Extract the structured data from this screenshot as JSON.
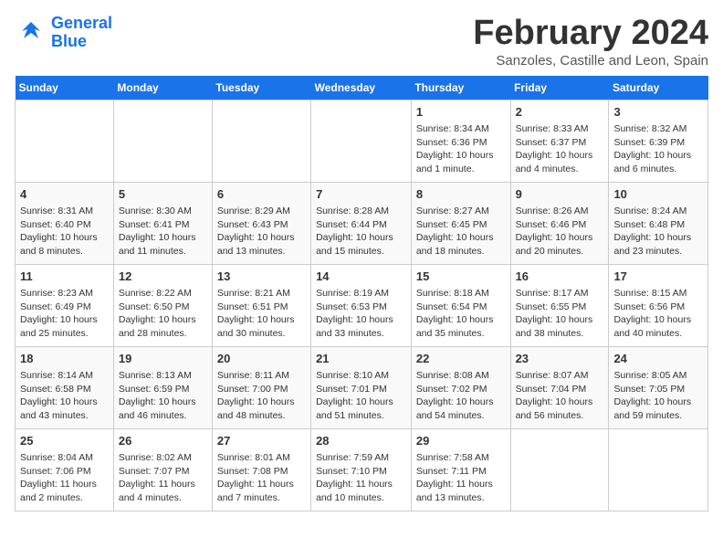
{
  "header": {
    "logo_line1": "General",
    "logo_line2": "Blue",
    "month_title": "February 2024",
    "location": "Sanzoles, Castille and Leon, Spain"
  },
  "days_of_week": [
    "Sunday",
    "Monday",
    "Tuesday",
    "Wednesday",
    "Thursday",
    "Friday",
    "Saturday"
  ],
  "weeks": [
    [
      {
        "day": "",
        "content": ""
      },
      {
        "day": "",
        "content": ""
      },
      {
        "day": "",
        "content": ""
      },
      {
        "day": "",
        "content": ""
      },
      {
        "day": "1",
        "content": "Sunrise: 8:34 AM\nSunset: 6:36 PM\nDaylight: 10 hours and 1 minute."
      },
      {
        "day": "2",
        "content": "Sunrise: 8:33 AM\nSunset: 6:37 PM\nDaylight: 10 hours and 4 minutes."
      },
      {
        "day": "3",
        "content": "Sunrise: 8:32 AM\nSunset: 6:39 PM\nDaylight: 10 hours and 6 minutes."
      }
    ],
    [
      {
        "day": "4",
        "content": "Sunrise: 8:31 AM\nSunset: 6:40 PM\nDaylight: 10 hours and 8 minutes."
      },
      {
        "day": "5",
        "content": "Sunrise: 8:30 AM\nSunset: 6:41 PM\nDaylight: 10 hours and 11 minutes."
      },
      {
        "day": "6",
        "content": "Sunrise: 8:29 AM\nSunset: 6:43 PM\nDaylight: 10 hours and 13 minutes."
      },
      {
        "day": "7",
        "content": "Sunrise: 8:28 AM\nSunset: 6:44 PM\nDaylight: 10 hours and 15 minutes."
      },
      {
        "day": "8",
        "content": "Sunrise: 8:27 AM\nSunset: 6:45 PM\nDaylight: 10 hours and 18 minutes."
      },
      {
        "day": "9",
        "content": "Sunrise: 8:26 AM\nSunset: 6:46 PM\nDaylight: 10 hours and 20 minutes."
      },
      {
        "day": "10",
        "content": "Sunrise: 8:24 AM\nSunset: 6:48 PM\nDaylight: 10 hours and 23 minutes."
      }
    ],
    [
      {
        "day": "11",
        "content": "Sunrise: 8:23 AM\nSunset: 6:49 PM\nDaylight: 10 hours and 25 minutes."
      },
      {
        "day": "12",
        "content": "Sunrise: 8:22 AM\nSunset: 6:50 PM\nDaylight: 10 hours and 28 minutes."
      },
      {
        "day": "13",
        "content": "Sunrise: 8:21 AM\nSunset: 6:51 PM\nDaylight: 10 hours and 30 minutes."
      },
      {
        "day": "14",
        "content": "Sunrise: 8:19 AM\nSunset: 6:53 PM\nDaylight: 10 hours and 33 minutes."
      },
      {
        "day": "15",
        "content": "Sunrise: 8:18 AM\nSunset: 6:54 PM\nDaylight: 10 hours and 35 minutes."
      },
      {
        "day": "16",
        "content": "Sunrise: 8:17 AM\nSunset: 6:55 PM\nDaylight: 10 hours and 38 minutes."
      },
      {
        "day": "17",
        "content": "Sunrise: 8:15 AM\nSunset: 6:56 PM\nDaylight: 10 hours and 40 minutes."
      }
    ],
    [
      {
        "day": "18",
        "content": "Sunrise: 8:14 AM\nSunset: 6:58 PM\nDaylight: 10 hours and 43 minutes."
      },
      {
        "day": "19",
        "content": "Sunrise: 8:13 AM\nSunset: 6:59 PM\nDaylight: 10 hours and 46 minutes."
      },
      {
        "day": "20",
        "content": "Sunrise: 8:11 AM\nSunset: 7:00 PM\nDaylight: 10 hours and 48 minutes."
      },
      {
        "day": "21",
        "content": "Sunrise: 8:10 AM\nSunset: 7:01 PM\nDaylight: 10 hours and 51 minutes."
      },
      {
        "day": "22",
        "content": "Sunrise: 8:08 AM\nSunset: 7:02 PM\nDaylight: 10 hours and 54 minutes."
      },
      {
        "day": "23",
        "content": "Sunrise: 8:07 AM\nSunset: 7:04 PM\nDaylight: 10 hours and 56 minutes."
      },
      {
        "day": "24",
        "content": "Sunrise: 8:05 AM\nSunset: 7:05 PM\nDaylight: 10 hours and 59 minutes."
      }
    ],
    [
      {
        "day": "25",
        "content": "Sunrise: 8:04 AM\nSunset: 7:06 PM\nDaylight: 11 hours and 2 minutes."
      },
      {
        "day": "26",
        "content": "Sunrise: 8:02 AM\nSunset: 7:07 PM\nDaylight: 11 hours and 4 minutes."
      },
      {
        "day": "27",
        "content": "Sunrise: 8:01 AM\nSunset: 7:08 PM\nDaylight: 11 hours and 7 minutes."
      },
      {
        "day": "28",
        "content": "Sunrise: 7:59 AM\nSunset: 7:10 PM\nDaylight: 11 hours and 10 minutes."
      },
      {
        "day": "29",
        "content": "Sunrise: 7:58 AM\nSunset: 7:11 PM\nDaylight: 11 hours and 13 minutes."
      },
      {
        "day": "",
        "content": ""
      },
      {
        "day": "",
        "content": ""
      }
    ]
  ]
}
